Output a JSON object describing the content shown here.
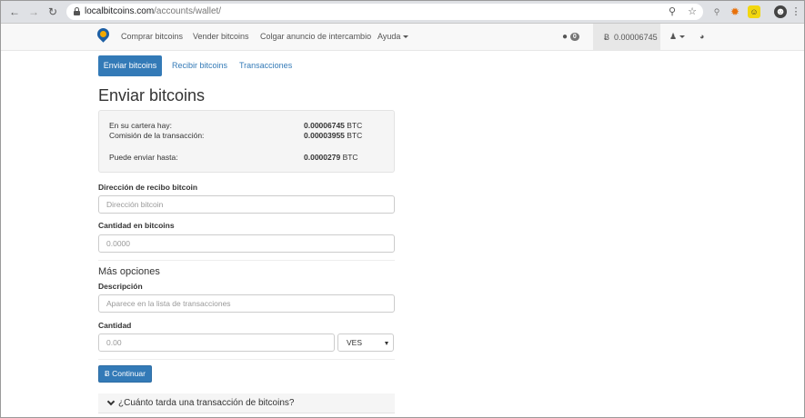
{
  "browser": {
    "url_domain": "localbitcoins.com",
    "url_path": "/accounts/wallet/"
  },
  "nav": {
    "items": [
      "Comprar bitcoins",
      "Vender bitcoins",
      "Colgar anuncio de intercambio",
      "Ayuda"
    ],
    "chat_count": "0",
    "balance": "0.00006745",
    "bitcoin_symbol": "Ƀ"
  },
  "tabs": {
    "active": "Enviar bitcoins",
    "others": [
      "Recibir bitcoins",
      "Transacciones"
    ]
  },
  "page_title": "Enviar bitcoins",
  "wallet": {
    "rows": [
      {
        "label": "En su cartera hay:",
        "value": "0.00006745",
        "unit": "BTC"
      },
      {
        "label": "Comisión de la transacción:",
        "value": "0.00003955",
        "unit": "BTC"
      },
      {
        "label": "Puede enviar hasta:",
        "value": "0.0000279",
        "unit": "BTC"
      }
    ]
  },
  "form": {
    "address_label": "Dirección de recibo bitcoin",
    "address_placeholder": "Dirección bitcoin",
    "amount_label": "Cantidad en bitcoins",
    "amount_placeholder": "0.0000",
    "more_options": "Más opciones",
    "description_label": "Descripción",
    "description_placeholder": "Aparece en la lista de transacciones",
    "fiat_label": "Cantidad",
    "fiat_placeholder": "0.00",
    "currency": "VES",
    "continue_label": "Continuar"
  },
  "faq": {
    "question": "¿Cuánto tarda una transacción de bitcoins?"
  }
}
